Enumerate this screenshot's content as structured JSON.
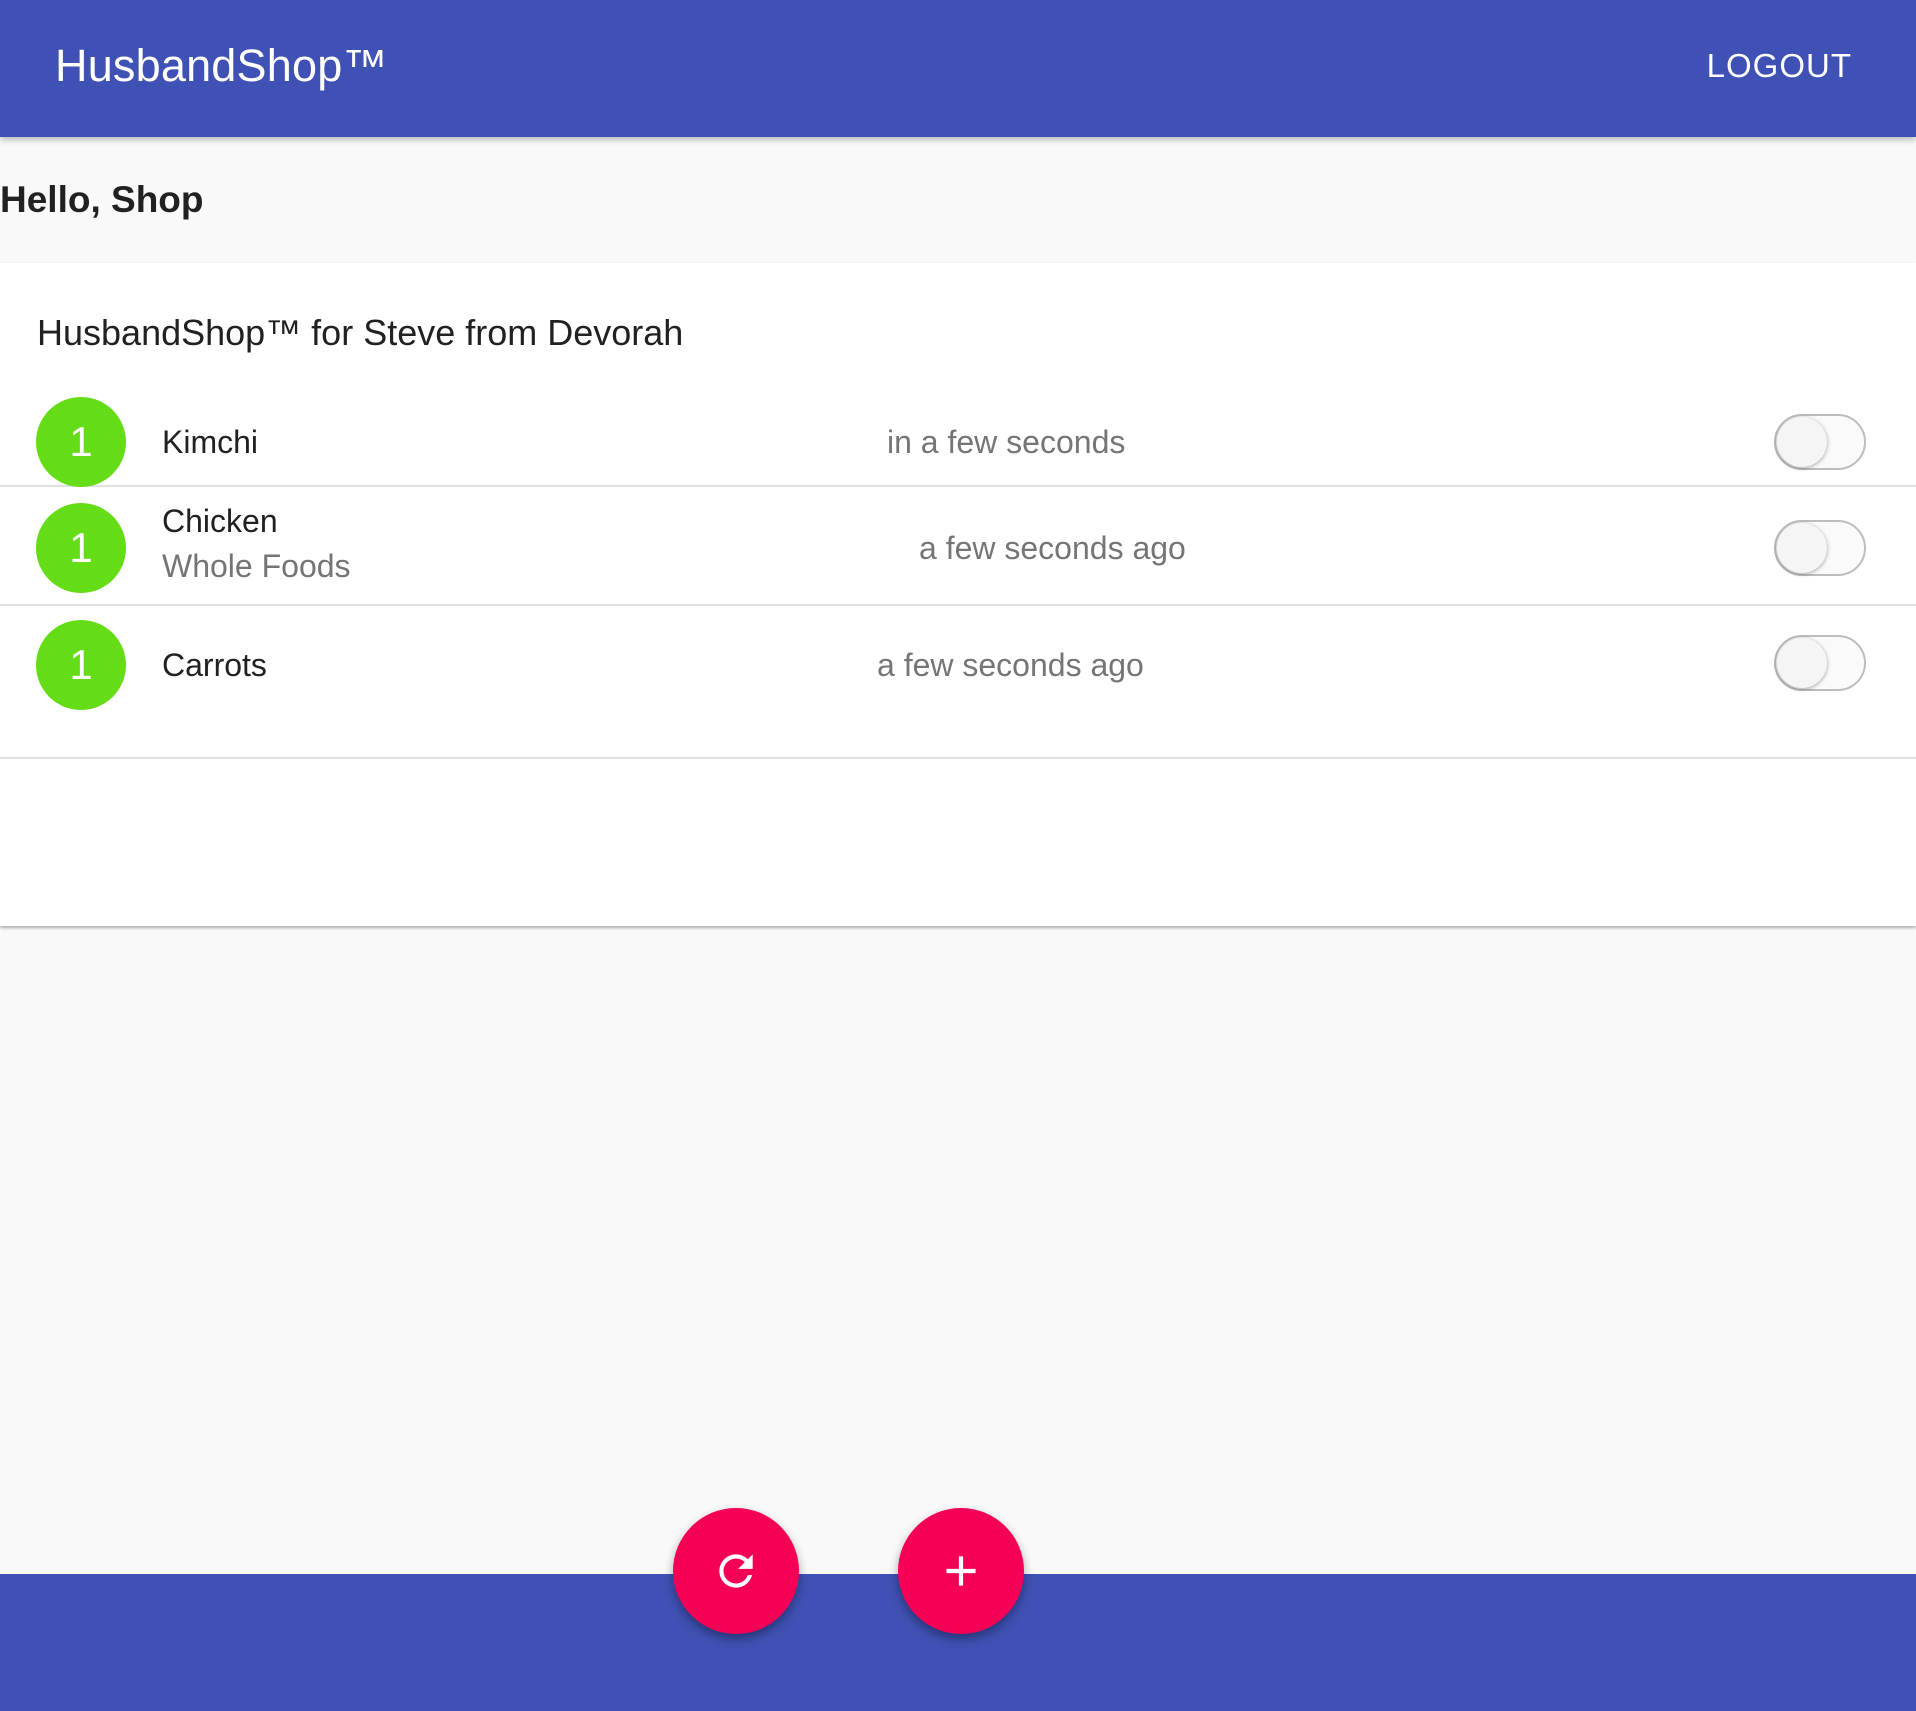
{
  "appbar": {
    "title": "HusbandShop™",
    "logout_label": "LOGOUT"
  },
  "greeting": "Hello, Shop",
  "card": {
    "title": "HusbandShop™ for Steve from Devorah",
    "items": [
      {
        "quantity": "1",
        "name": "Kimchi",
        "store": "",
        "time": "in a few seconds",
        "checked": false
      },
      {
        "quantity": "1",
        "name": "Chicken",
        "store": "Whole Foods",
        "time": "a few seconds ago",
        "checked": false
      },
      {
        "quantity": "1",
        "name": "Carrots",
        "store": "",
        "time": "a few seconds ago",
        "checked": false
      }
    ]
  },
  "fabs": {
    "refresh_icon": "refresh-icon",
    "add_icon": "plus-icon"
  },
  "colors": {
    "primary": "#3f51b5",
    "accent": "#f50057",
    "avatar": "#64dd17"
  }
}
